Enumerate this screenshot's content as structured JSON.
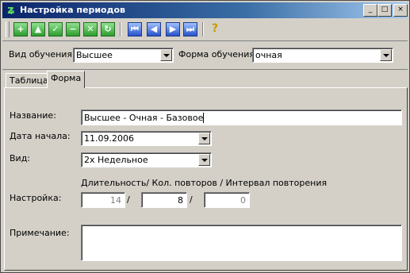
{
  "window": {
    "title": "Настройка периодов",
    "controls": {
      "minimize": "_",
      "maximize": "□",
      "close": "×"
    }
  },
  "toolbar": {
    "buttons": [
      {
        "name": "add",
        "glyph": "+",
        "color": "green"
      },
      {
        "name": "up",
        "glyph": "▲",
        "color": "green"
      },
      {
        "name": "confirm",
        "glyph": "✓",
        "color": "green"
      },
      {
        "name": "remove",
        "glyph": "−",
        "color": "green"
      },
      {
        "name": "cancel",
        "glyph": "✕",
        "color": "green"
      },
      {
        "name": "refresh",
        "glyph": "↻",
        "color": "green"
      },
      {
        "name": "first",
        "glyph": "⏮",
        "color": "blue"
      },
      {
        "name": "prev",
        "glyph": "◀",
        "color": "blue"
      },
      {
        "name": "next",
        "glyph": "▶",
        "color": "blue"
      },
      {
        "name": "last",
        "glyph": "⏭",
        "color": "blue"
      },
      {
        "name": "help",
        "glyph": "?",
        "color": "help"
      }
    ]
  },
  "filters": {
    "study_type_label": "Вид обучения:",
    "study_type_value": "Высшее",
    "study_form_label": "Форма обучения:",
    "study_form_value": "очная"
  },
  "tabs": [
    {
      "label": "Таблица",
      "active": false
    },
    {
      "label": "Форма",
      "active": true
    }
  ],
  "form": {
    "name_label": "Название:",
    "name_value": "Высшее - Очная - Базовое",
    "start_date_label": "Дата начала:",
    "start_date_value": "11.09.2006",
    "kind_label": "Вид:",
    "kind_value": "2х Недельное",
    "settings_header": "Длительность/ Кол. повторов / Интервал повторения",
    "settings_label": "Настройка:",
    "duration_value": "14",
    "separator": "/",
    "repeat_count_value": "8",
    "repeat_interval_value": "0",
    "note_label": "Примечание:",
    "note_value": ""
  }
}
